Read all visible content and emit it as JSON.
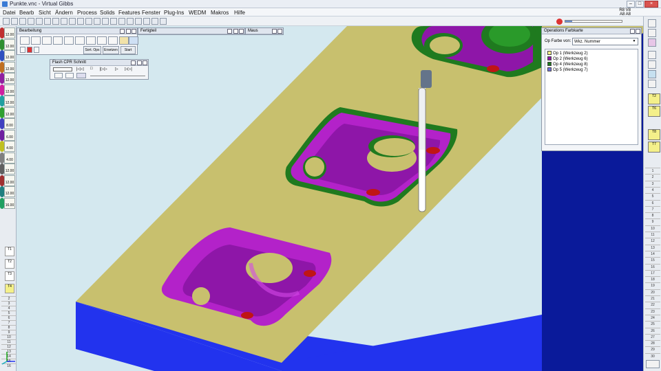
{
  "window": {
    "title": "Punkte.vnc - Virtual Gibbs"
  },
  "menu": [
    "Datei",
    "Bearb",
    "Sicht",
    "Ändern",
    "Process",
    "Solids",
    "Features",
    "Fenster",
    "Plug-Ins",
    "WEDM",
    "Makros",
    "Hilfe"
  ],
  "menu_right": {
    "line1": "R8  V8",
    "line2": "A8  A8"
  },
  "progress": {
    "value": 0.12
  },
  "panels": {
    "bearbeitung": {
      "title": "Bearbeitung",
      "buttons": [
        "Sort. Ops",
        "Ersetzen",
        "Start"
      ]
    },
    "fertigteil": {
      "title": "Fertigteil"
    },
    "maus": {
      "title": "Maus"
    },
    "flash": {
      "title": "Flash CPR Schnitt"
    },
    "opfarbe": {
      "title": "Operations Farbkarte",
      "label": "Op Farbe von:",
      "select_value": "Wkz. Nummer",
      "items": [
        {
          "label": "Op 1 (Werkzeug 2)",
          "color": "#f7f08a"
        },
        {
          "label": "Op 2 (Werkzeug 6)",
          "color": "#8e16a8"
        },
        {
          "label": "Op 4 (Werkzeug 8)",
          "color": "#1f7a1f"
        },
        {
          "label": "Op 5 (Werkzeug 7)",
          "color": "#7070e0"
        }
      ]
    }
  },
  "left_tools": [
    {
      "num": "1",
      "val": "12.00",
      "color": "#c03030"
    },
    {
      "num": "2",
      "val": "12.00",
      "color": "#2f8f2f"
    },
    {
      "num": "3",
      "val": "12.00",
      "color": "#3050c0"
    },
    {
      "num": "4",
      "val": "12.00",
      "color": "#c07020"
    },
    {
      "num": "5",
      "val": "12.00",
      "color": "#9020a0"
    },
    {
      "num": "6",
      "val": "12.00",
      "color": "#d020a0"
    },
    {
      "num": "7",
      "val": "12.00",
      "color": "#20a0a0"
    },
    {
      "num": "8",
      "val": "12.00",
      "color": "#30a030"
    },
    {
      "num": "9",
      "val": "8.00",
      "color": "#4040c0"
    },
    {
      "num": "10",
      "val": "6.00",
      "color": "#7020a0"
    },
    {
      "num": "11",
      "val": "4.00",
      "color": "#c0c020"
    },
    {
      "num": "12",
      "val": "4.00",
      "color": "#808080"
    },
    {
      "num": "13",
      "val": "12.00",
      "color": "#606060"
    },
    {
      "num": "14",
      "val": "12.00",
      "color": "#a03030"
    },
    {
      "num": "15",
      "val": "12.00",
      "color": "#208080"
    },
    {
      "num": "16",
      "val": "16.00",
      "color": "#20a060"
    }
  ],
  "ruler_left": [
    "2",
    "3",
    "4",
    "5",
    "6",
    "7",
    "8",
    "9",
    "10",
    "11",
    "12",
    "13",
    "14",
    "15",
    "16"
  ],
  "ruler_right": [
    "1",
    "2",
    "3",
    "4",
    "5",
    "6",
    "7",
    "8",
    "9",
    "10",
    "11",
    "12",
    "13",
    "14",
    "15",
    "16",
    "17",
    "18",
    "19",
    "20",
    "21",
    "22",
    "23",
    "24",
    "25",
    "26",
    "27",
    "28",
    "29",
    "30"
  ],
  "colors": {
    "block_top": "#c8c06e",
    "block_front": "#2233ee",
    "block_side": "#0a1a9a",
    "pocket": "#8e16a8",
    "pocket_wall": "#b322c9",
    "green": "#1f7a1f",
    "red_mark": "#c01515",
    "background": "#d4e8ef"
  }
}
